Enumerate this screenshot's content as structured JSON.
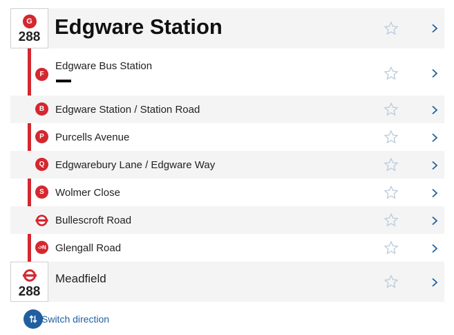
{
  "origin": {
    "route_number": "288",
    "stop_letter": "G",
    "title": "Edgware Station"
  },
  "stops": [
    {
      "letter": "F",
      "name": "Edgware Bus Station",
      "icon": "stop-letter"
    },
    {
      "letter": "B",
      "name": "Edgware Station / Station Road",
      "icon": "stop-letter"
    },
    {
      "letter": "P",
      "name": "Purcells Avenue",
      "icon": "stop-letter"
    },
    {
      "letter": "Q",
      "name": "Edgwarebury Lane / Edgware Way",
      "icon": "stop-letter"
    },
    {
      "letter": "S",
      "name": "Wolmer Close",
      "icon": "stop-letter"
    },
    {
      "letter": "",
      "name": "Bullescroft Road",
      "icon": "roundel-icon"
    },
    {
      "letter": "->N",
      "name": "Glengall Road",
      "icon": "stop-letter"
    }
  ],
  "destination": {
    "route_number": "288",
    "title": "Meadfield",
    "icon": "roundel-icon"
  },
  "switch_direction_label": "Switch direction",
  "colors": {
    "route_red": "#d4272f",
    "link_blue": "#1f5fa0",
    "star_outline": "#b9c9dc",
    "chevron": "#1f5fa0",
    "row_grey": "#f4f4f4"
  }
}
